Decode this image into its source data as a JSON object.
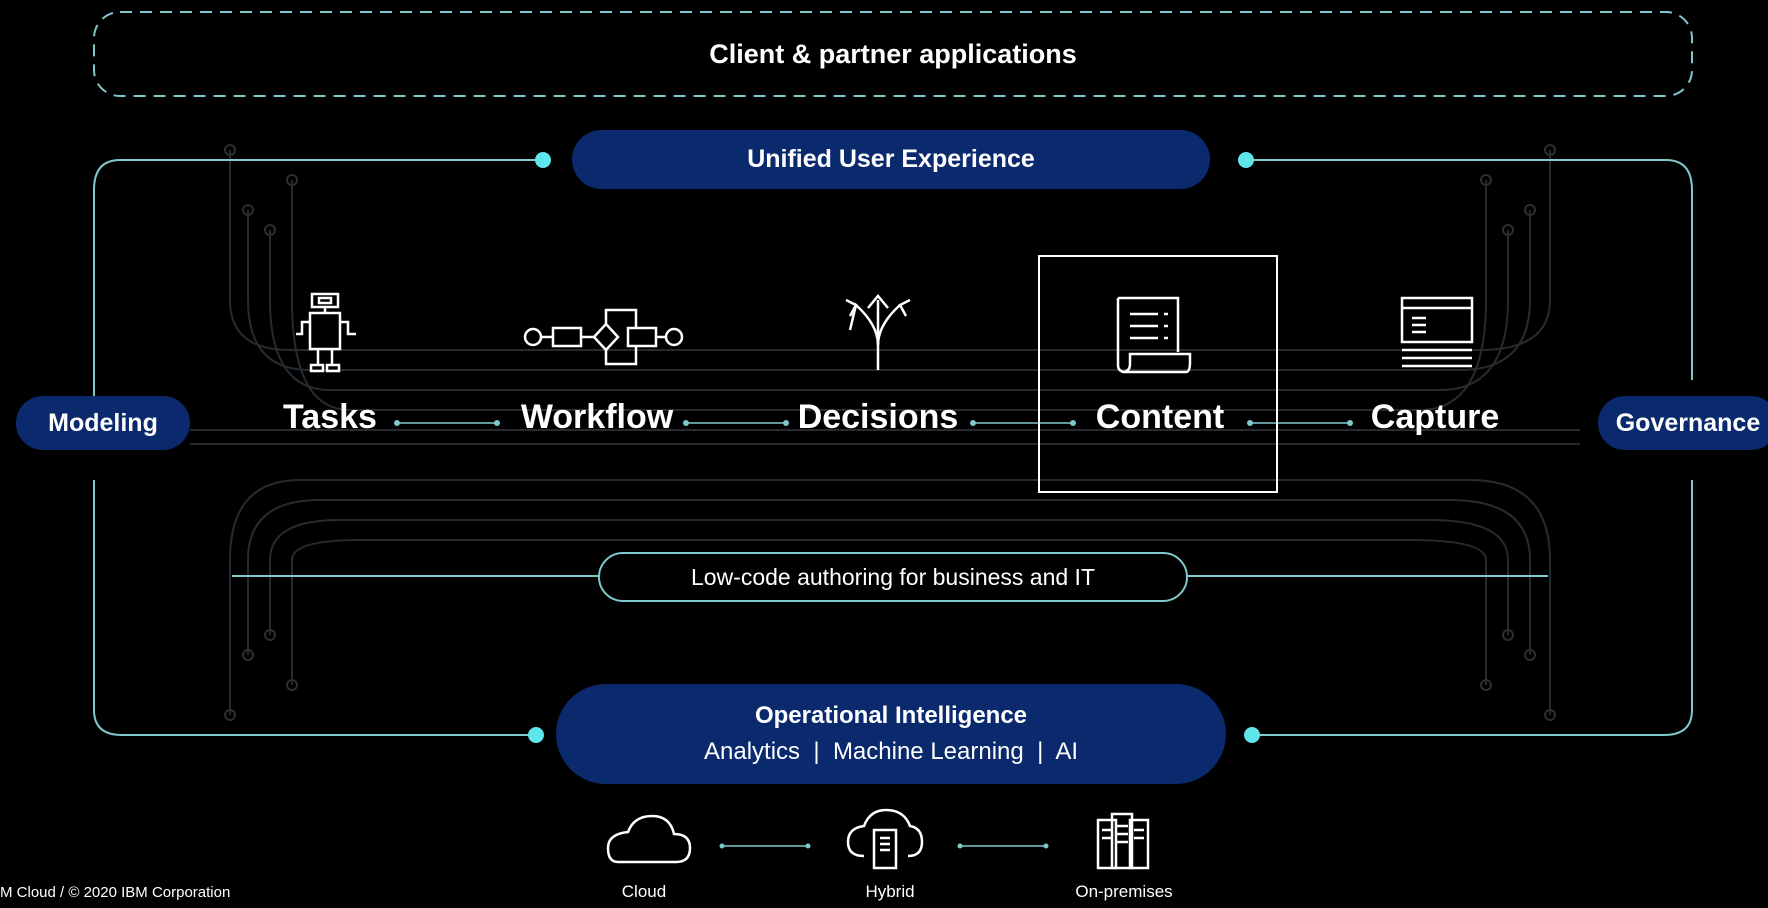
{
  "title": "Client & partner applications",
  "top_bar": "Unified User Experience",
  "left_pill": "Modeling",
  "right_pill": "Governance",
  "capabilities": [
    "Tasks",
    "Workflow",
    "Decisions",
    "Content",
    "Capture"
  ],
  "authoring": "Low-code authoring for business and IT",
  "intelligence": {
    "title": "Operational Intelligence",
    "subtitle": "Analytics  |  Machine Learning  |  AI"
  },
  "deployment": [
    "Cloud",
    "Hybrid",
    "On-premises"
  ],
  "footer": "M Cloud / © 2020 IBM Corporation",
  "colors": {
    "accent": "#5ee6ea",
    "pill": "#0b2a6e",
    "line": "#7fc8cc",
    "trace": "#2a2f33"
  },
  "icons": [
    "robot-icon",
    "workflow-icon",
    "decision-arrows-icon",
    "document-icon",
    "scanner-window-icon",
    "cloud-icon",
    "hybrid-cloud-icon",
    "server-icon"
  ]
}
